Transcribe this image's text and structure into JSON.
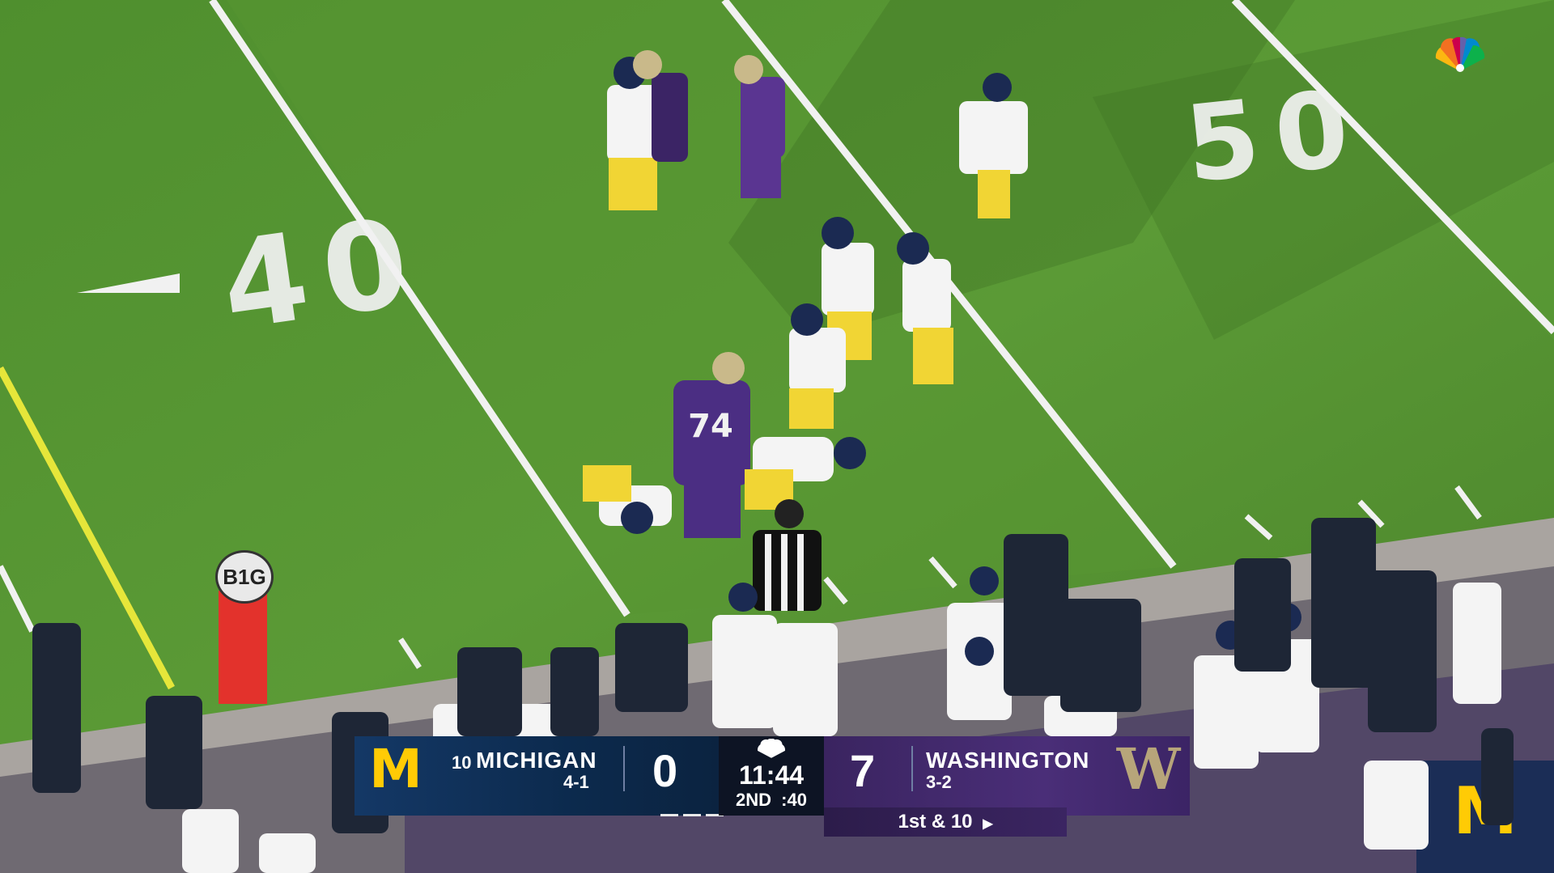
{
  "broadcast": {
    "network_logo": "nbc-peacock-icon",
    "conference_marker": "B1G"
  },
  "field": {
    "yard_numbers": [
      "40",
      "50"
    ]
  },
  "scoreboard": {
    "away": {
      "logo": "M",
      "rank": "10",
      "name": "MICHIGAN",
      "record": "4-1",
      "score": "0",
      "color": "#ffcb05"
    },
    "home": {
      "logo": "W",
      "name": "WASHINGTON",
      "record": "3-2",
      "score": "7",
      "color": "#4b2e83"
    },
    "clock": {
      "game_clock": "11:44",
      "quarter": "2ND",
      "play_clock": ":40"
    },
    "down_distance": "1st & 10",
    "down_arrow_icon": "play-arrow-icon"
  },
  "colors": {
    "michigan_navy": "#0c2a4d",
    "washington_purple": "#4a2e78",
    "field_green": "#4e8a2c"
  }
}
